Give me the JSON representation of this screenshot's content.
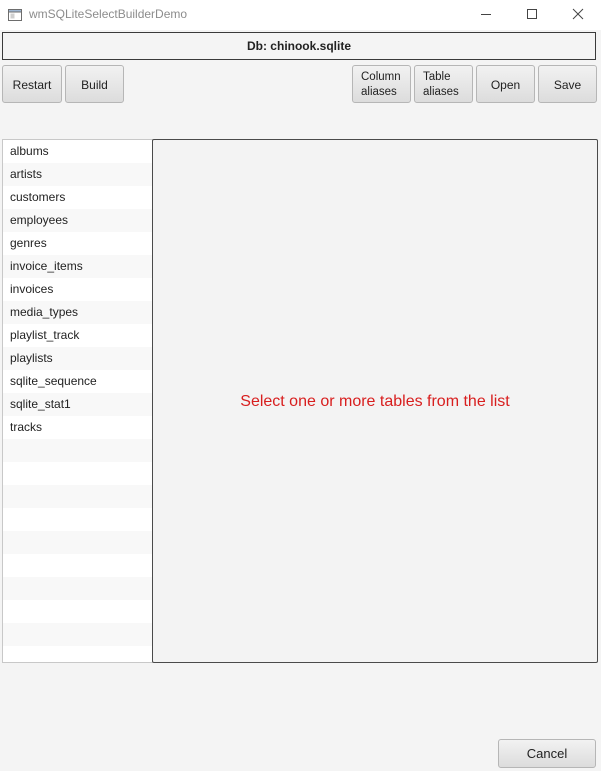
{
  "window": {
    "title": "wmSQLiteSelectBuilderDemo",
    "icons": {
      "app": "app-window-icon",
      "minimize": "minimize-icon",
      "maximize": "maximize-icon",
      "close": "close-icon"
    }
  },
  "header": {
    "db_label": "Db: chinook.sqlite"
  },
  "toolbar": {
    "restart_label": "Restart",
    "build_label": "Build",
    "column_aliases_line1": "Column",
    "column_aliases_line2": "aliases",
    "table_aliases_line1": "Table",
    "table_aliases_line2": "aliases",
    "open_label": "Open",
    "save_label": "Save"
  },
  "tables": {
    "items": [
      "albums",
      "artists",
      "customers",
      "employees",
      "genres",
      "invoice_items",
      "invoices",
      "media_types",
      "playlist_track",
      "playlists",
      "sqlite_sequence",
      "sqlite_stat1",
      "tracks"
    ]
  },
  "main": {
    "message": "Select one or more tables from the list",
    "message_color": "#d81e1e"
  },
  "footer": {
    "cancel_label": "Cancel"
  }
}
